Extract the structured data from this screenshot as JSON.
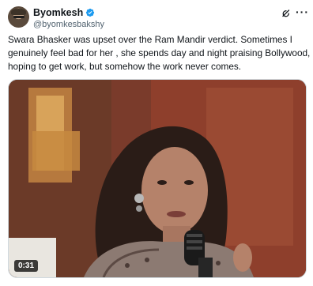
{
  "author": {
    "display_name": "Byomkesh",
    "handle": "@byomkesbakshy",
    "avatar_icon": "avatar-image",
    "verified_icon": "verified-badge-icon"
  },
  "actions": {
    "grok_icon": "grok-icon",
    "more_icon": "more-options-icon"
  },
  "tweet": {
    "lines": [
      "Swara Bhasker was upset over the Ram Mandir verdict. Sometimes I",
      "genuinely feel bad for her , she spends day and night praising Bollywood,",
      "hoping to get work, but somehow the work never comes."
    ]
  },
  "media": {
    "type": "video",
    "duration": "0:31"
  },
  "colors": {
    "text_primary": "#0f1419",
    "text_secondary": "#536471",
    "verified_blue": "#1d9bf0",
    "border": "#cfd9de"
  }
}
